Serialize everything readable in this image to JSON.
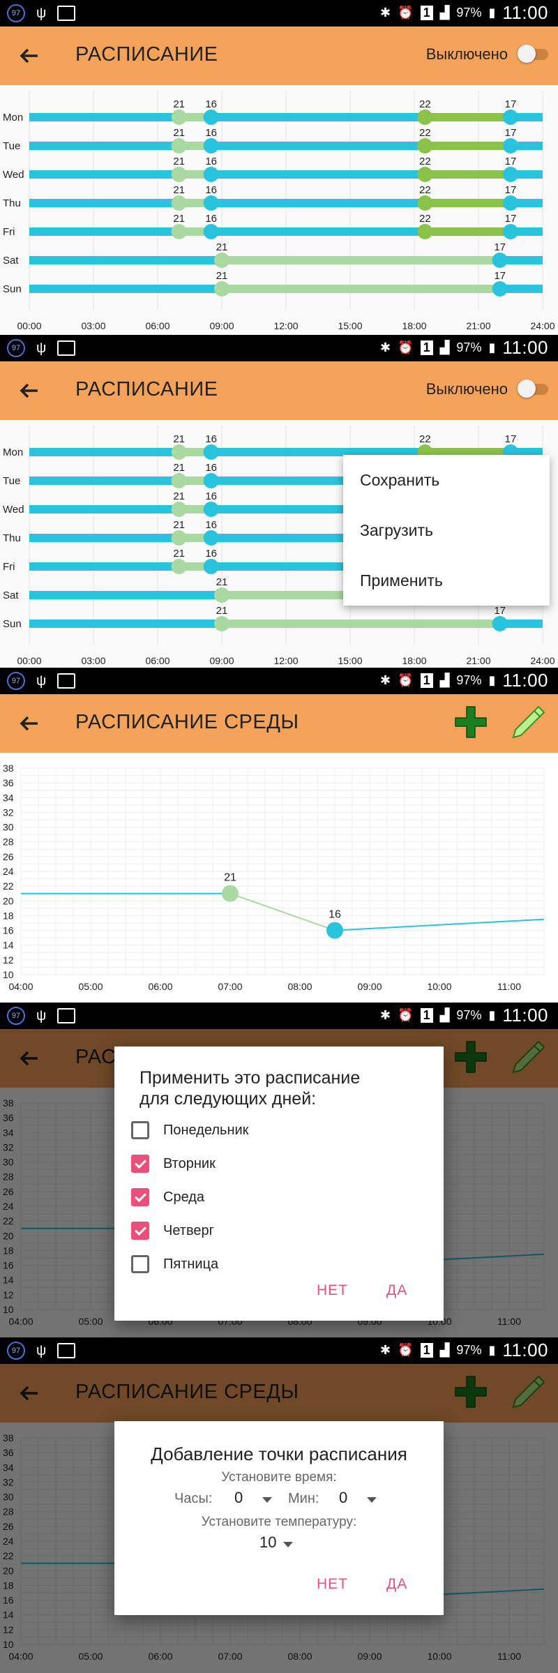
{
  "status_bar": {
    "badge": "97",
    "battery": "97%",
    "sim": "1",
    "time": "11:00"
  },
  "schedule": {
    "title": "РАСПИСАНИЕ",
    "switch_label": "Выключено",
    "days": [
      "Mon",
      "Tue",
      "Wed",
      "Thu",
      "Fri",
      "Sat",
      "Sun"
    ],
    "weekday_points": [
      "21",
      "16",
      "22",
      "17"
    ],
    "weekend_points": [
      "21",
      "17"
    ],
    "time_ticks": [
      "00:00",
      "03:00",
      "06:00",
      "09:00",
      "12:00",
      "15:00",
      "18:00",
      "21:00",
      "24:00"
    ]
  },
  "menu": {
    "items": [
      "Сохранить",
      "Загрузить",
      "Применить"
    ]
  },
  "day_view": {
    "title": "РАСПИСАНИЕ СРЕДЫ",
    "y_ticks": [
      "38",
      "36",
      "34",
      "32",
      "30",
      "28",
      "26",
      "24",
      "22",
      "20",
      "18",
      "16",
      "14",
      "12",
      "10"
    ],
    "x_ticks": [
      "04:00",
      "05:00",
      "06:00",
      "07:00",
      "08:00",
      "09:00",
      "10:00",
      "11:00"
    ],
    "point_labels": [
      "21",
      "16"
    ]
  },
  "apply_dialog": {
    "title_line1": "Применить это расписание",
    "title_line2": "для следующих дней:",
    "days": [
      {
        "label": "Понедельник",
        "checked": false
      },
      {
        "label": "Вторник",
        "checked": true
      },
      {
        "label": "Среда",
        "checked": true
      },
      {
        "label": "Четверг",
        "checked": true
      },
      {
        "label": "Пятница",
        "checked": false
      }
    ],
    "cancel": "НЕТ",
    "ok": "ДА"
  },
  "add_dialog": {
    "title": "Добавление точки расписания",
    "set_time": "Установите время:",
    "hours_label": "Часы:",
    "hours_value": "0",
    "minutes_label": "Мин:",
    "minutes_value": "0",
    "set_temp": "Установите температуру:",
    "temp_value": "10",
    "cancel": "НЕТ",
    "ok": "ДА"
  },
  "chart_data": {
    "type": "line",
    "x": [
      "04:00",
      "07:00",
      "08:30",
      "11:30"
    ],
    "y": [
      21,
      21,
      16,
      17.5
    ],
    "point_labels": {
      "07:00": 21,
      "08:30": 16
    },
    "ylim": [
      10,
      38
    ],
    "xlim": [
      "04:00",
      "11:30"
    ],
    "grid": true
  },
  "colors": {
    "appbar": "#f5a35a",
    "status": "#000000",
    "blue": "#29c3dd",
    "green": "#8bc34a",
    "light_green": "#a9d9a0",
    "accent": "#e84f7b"
  }
}
